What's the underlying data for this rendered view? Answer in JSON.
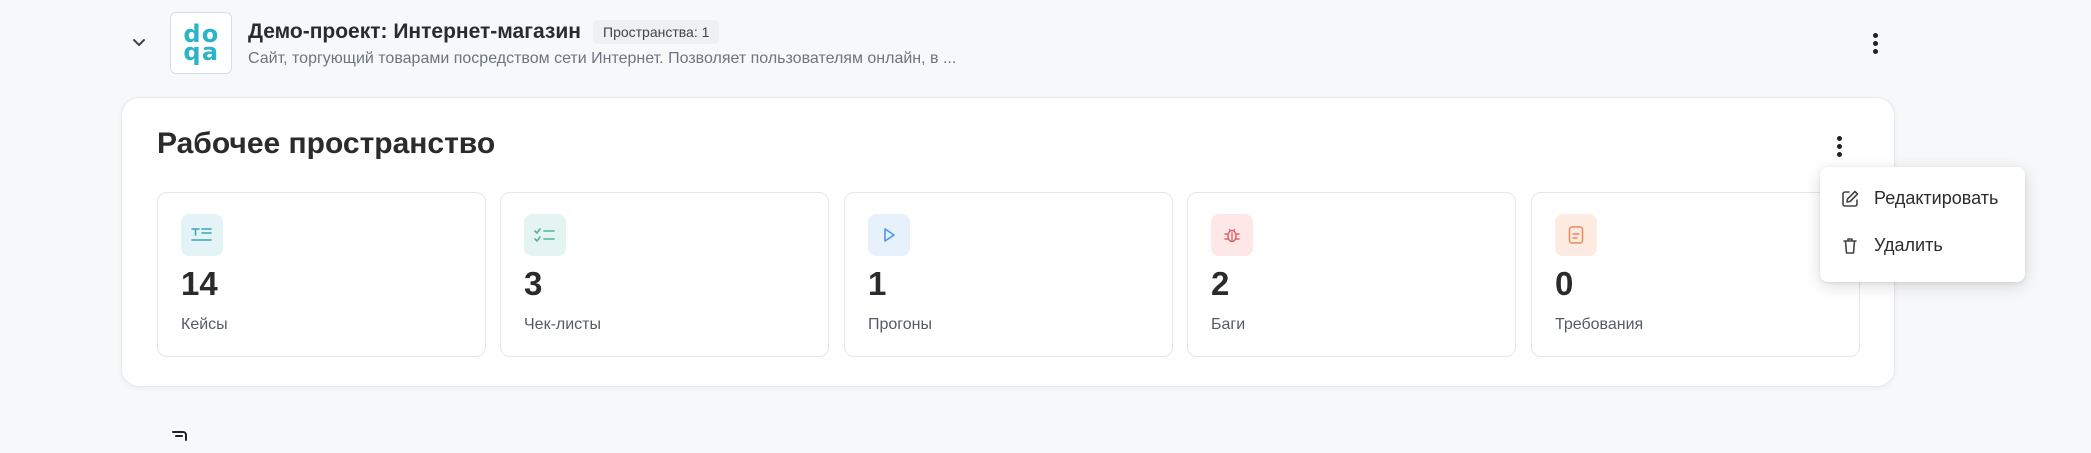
{
  "project": {
    "title": "Демо-проект: Интернет-магазин",
    "spaces_badge": "Пространства: 1",
    "description": "Сайт, торгующий товарами посредством сети Интернет. Позволяет пользователям онлайн, в ...",
    "logo_letters": [
      "d",
      "o",
      "q",
      "a"
    ],
    "logo_color": "#2bb3c7"
  },
  "workspace": {
    "title": "Рабочее пространство",
    "stats": [
      {
        "value": "14",
        "label": "Кейсы",
        "icon": "test-cases-icon",
        "bg": "#e3f3f6",
        "color": "#3aa7b8"
      },
      {
        "value": "3",
        "label": "Чек-листы",
        "icon": "checklist-icon",
        "bg": "#e4f4f1",
        "color": "#4fb3a0"
      },
      {
        "value": "1",
        "label": "Прогоны",
        "icon": "play-icon",
        "bg": "#e6f1fb",
        "color": "#4a9be0"
      },
      {
        "value": "2",
        "label": "Баги",
        "icon": "bug-icon",
        "bg": "#fde7e7",
        "color": "#e06565"
      },
      {
        "value": "0",
        "label": "Требования",
        "icon": "document-icon",
        "bg": "#fdebe1",
        "color": "#e9895a"
      }
    ]
  },
  "menu": {
    "items": [
      {
        "label": "Редактировать",
        "icon": "edit-icon"
      },
      {
        "label": "Удалить",
        "icon": "trash-icon"
      }
    ]
  }
}
